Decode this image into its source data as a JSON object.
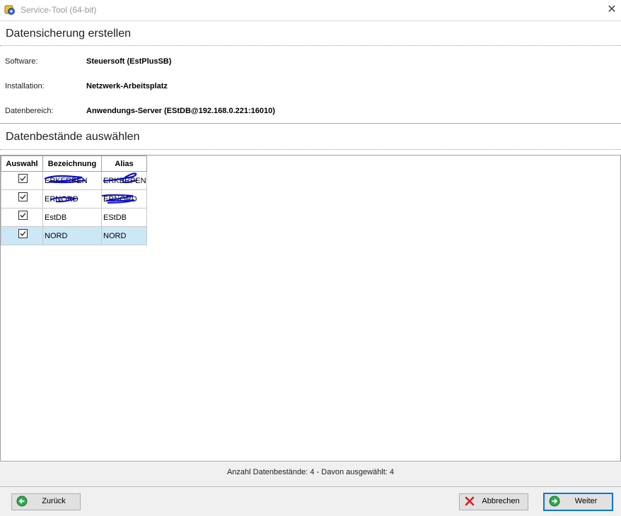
{
  "window": {
    "title": "Service-Tool (64-bit)"
  },
  "section1": {
    "title": "Datensicherung erstellen"
  },
  "info": [
    {
      "label": "Software:",
      "value": "Steuersoft (EstPlusSB)"
    },
    {
      "label": "Installation:",
      "value": "Netzwerk-Arbeitsplatz"
    },
    {
      "label": "Datenbereich:",
      "value": "Anwendungs-Server (EStDB@192.168.0.221:16010)"
    }
  ],
  "section2": {
    "title": "Datenbestände auswählen"
  },
  "table": {
    "headers": [
      "Auswahl",
      "Bezeichnung",
      "Alias"
    ],
    "rows": [
      {
        "checked": true,
        "bezeichnung": "ERKERPEN",
        "alias": "ERKERPEN"
      },
      {
        "checked": true,
        "bezeichnung": "ERNORD",
        "alias": "ERNORD"
      },
      {
        "checked": true,
        "bezeichnung": "EstDB",
        "alias": "EStDB"
      },
      {
        "checked": true,
        "bezeichnung": "NORD",
        "alias": "NORD"
      }
    ]
  },
  "status": {
    "text": "Anzahl Datenbestände: 4 - Davon ausgewählt: 4"
  },
  "buttons": {
    "back": "Zurück",
    "cancel": "Abbrechen",
    "next": "Weiter"
  },
  "colors": {
    "accent": "#0078d7",
    "selection": "#cce8f7",
    "scribble": "#1010c8"
  },
  "icons": {
    "app": "app-icon",
    "close": "close-icon",
    "back": "green-arrow-left-icon",
    "cancel": "red-x-icon",
    "next": "green-arrow-right-icon"
  }
}
